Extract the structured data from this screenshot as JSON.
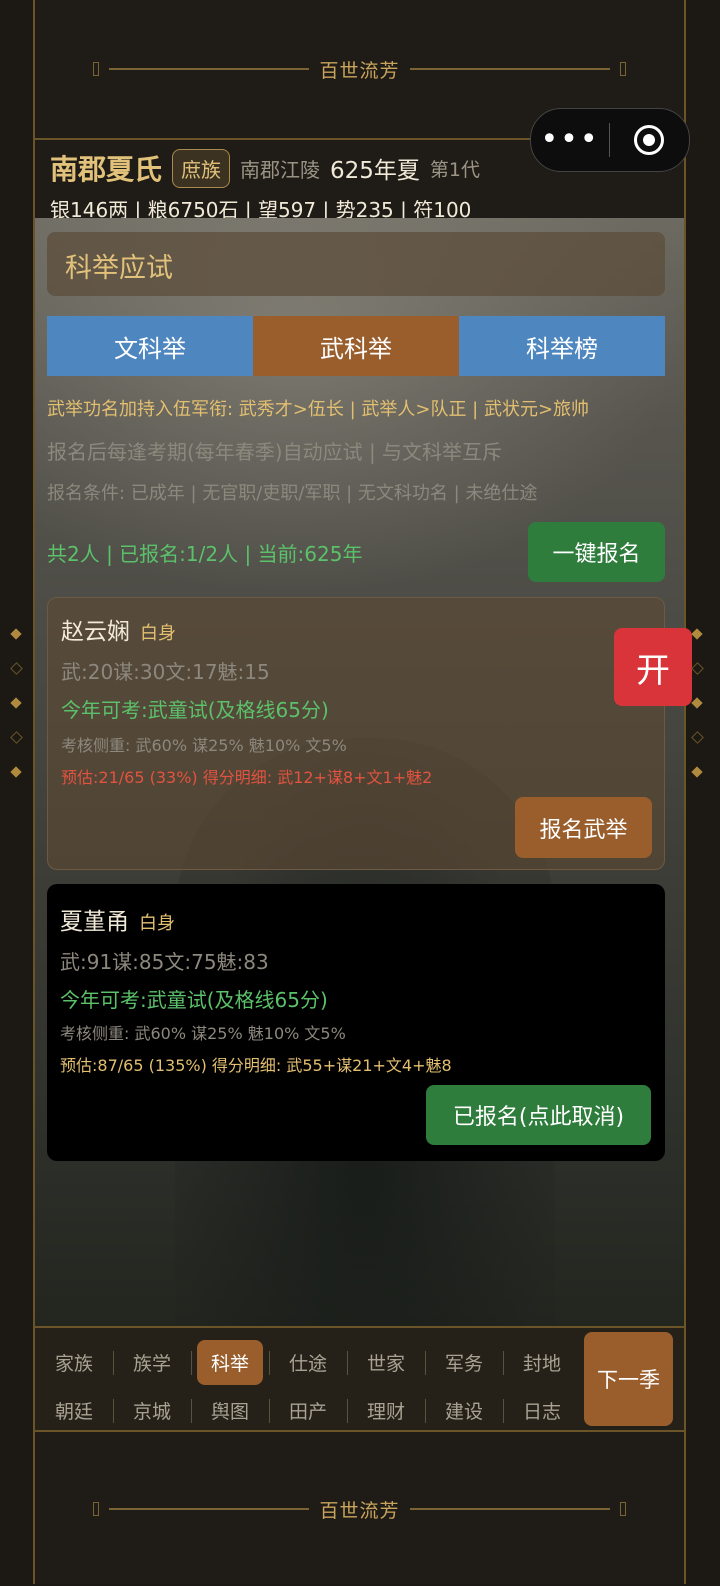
{
  "banner": {
    "title": "百世流芳"
  },
  "capsule": {
    "more_icon": "more-dots-icon",
    "close_icon": "target-icon"
  },
  "status": {
    "family": "南郡夏氏",
    "rank_badge": "庶族",
    "location": "南郡江陵",
    "year": "625年夏",
    "generation": "第1代",
    "resources": "银146两 | 粮6750石 | 望597 | 势235 | 符100"
  },
  "page": {
    "title": "科举应试"
  },
  "tabs": [
    {
      "label": "文科举"
    },
    {
      "label": "武科举",
      "active": true
    },
    {
      "label": "科举榜"
    }
  ],
  "info": {
    "line1": "武举功名加持入伍军衔: 武秀才>伍长 | 武举人>队正 | 武状元>旅帅",
    "line2": "报名后每逢考期(每年春季)自动应试 | 与文科举互斥",
    "line3": "报名条件: 已成年 | 无官职/吏职/军职 | 无文科功名 | 未绝仕途"
  },
  "summary": "共2人 | 已报名:1/2人 | 当前:625年",
  "one_click_label": "一键报名",
  "kai_label": "开",
  "candidates": [
    {
      "name": "赵云娴",
      "status": "白身",
      "attributes": "武:20谋:30文:17魅:15",
      "exam": "今年可考:武童试(及格线65分)",
      "weights": "考核侧重: 武60% 谋25% 魅10% 文5%",
      "estimate": "预估:21/65 (33%)  得分明细: 武12+谋8+文1+魅2",
      "action": "报名武举"
    },
    {
      "name": "夏堇甬",
      "status": "白身",
      "attributes": "武:91谋:85文:75魅:83",
      "exam": "今年可考:武童试(及格线65分)",
      "weights": "考核侧重: 武60% 谋25% 魅10% 文5%",
      "estimate": "预估:87/65 (135%)  得分明细: 武55+谋21+文4+魅8",
      "action": "已报名(点此取消)"
    }
  ],
  "nav": {
    "row1": [
      "家族",
      "族学",
      "科举",
      "仕途",
      "世家",
      "军务",
      "封地"
    ],
    "row2": [
      "朝廷",
      "京城",
      "舆图",
      "田产",
      "理财",
      "建设",
      "日志"
    ],
    "active": "科举",
    "next_season": "下一季"
  },
  "colors": {
    "accent_gold": "#e2c27a",
    "tab_blue": "#4e86bf",
    "tab_brown": "#9a5e2d",
    "green": "#2f7d3c",
    "red": "#d9343a"
  }
}
